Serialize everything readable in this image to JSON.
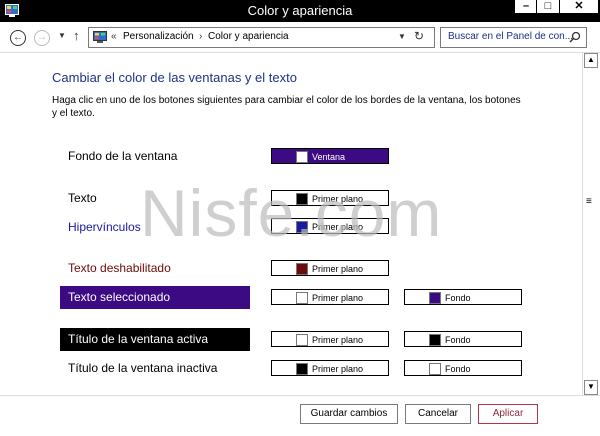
{
  "window": {
    "title": "Color y apariencia"
  },
  "caption_buttons": {
    "minimize": "–",
    "maximize": "□",
    "close": "✕"
  },
  "nav": {
    "back_glyph": "←",
    "forward_glyph": "→",
    "up_glyph": "↑",
    "breadcrumb": {
      "chevron": "«",
      "item1": "Personalización",
      "separator": "›",
      "item2": "Color y apariencia"
    },
    "search_placeholder": "Buscar en el Panel de con..."
  },
  "main": {
    "heading": "Cambiar el color de las ventanas y el texto",
    "description": "Haga clic en uno de los botones siguientes para cambiar el color de los bordes de la ventana, los botones y el texto.",
    "rows": [
      {
        "label": "Fondo de la ventana",
        "buttons": [
          {
            "label": "Ventana",
            "swatch": "#ffffff"
          }
        ]
      },
      {
        "label": "Texto",
        "buttons": [
          {
            "label": "Primer plano",
            "swatch": "#000000"
          }
        ]
      },
      {
        "label": "Hipervínculos",
        "buttons": [
          {
            "label": "Primer plano",
            "swatch": "#1a1a9e"
          }
        ]
      },
      {
        "label": "Texto deshabilitado",
        "buttons": [
          {
            "label": "Primer plano",
            "swatch": "#6d0a0a"
          }
        ]
      },
      {
        "label": "Texto seleccionado",
        "buttons": [
          {
            "label": "Primer plano",
            "swatch": "#ffffff"
          },
          {
            "label": "Fondo",
            "swatch": "#3c0a82"
          }
        ]
      },
      {
        "label": "Título de la ventana activa",
        "buttons": [
          {
            "label": "Primer plano",
            "swatch": "#ffffff"
          },
          {
            "label": "Fondo",
            "swatch": "#000000"
          }
        ]
      },
      {
        "label": "Título de la ventana inactiva",
        "buttons": [
          {
            "label": "Primer plano",
            "swatch": "#000000"
          },
          {
            "label": "Fondo",
            "swatch": "#ffffff"
          }
        ]
      }
    ]
  },
  "footer": {
    "save": "Guardar cambios",
    "cancel": "Cancelar",
    "apply": "Aplicar"
  },
  "watermark": "Nisfe.com",
  "colors": {
    "title_bar": "#000000",
    "selected_bg": "#3c0a82",
    "link": "#1a1a9e",
    "disabled": "#6d0a0a",
    "heading": "#1e3287"
  },
  "icons": {
    "app": "control-panel-icon",
    "search": "search-icon",
    "refresh": "refresh-icon"
  }
}
